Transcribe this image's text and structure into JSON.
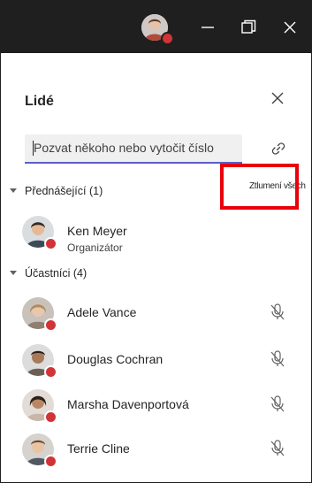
{
  "panel": {
    "title": "Lidé",
    "search_placeholder": "Pozvat někoho nebo vytočit číslo"
  },
  "presenters": {
    "header": "Přednášející (1)",
    "mute_all_label": "Ztlumení všech",
    "people": [
      {
        "name": "Ken Meyer",
        "role": "Organizátor",
        "presence": "busy"
      }
    ]
  },
  "attendees": {
    "header": "Účastníci (4)",
    "people": [
      {
        "name": "Adele Vance",
        "presence": "busy",
        "mic": "muted"
      },
      {
        "name": "Douglas Cochran",
        "presence": "busy",
        "mic": "muted"
      },
      {
        "name": "Marsha Davenportová",
        "presence": "busy",
        "mic": "muted"
      },
      {
        "name": "Terrie Cline",
        "presence": "busy",
        "mic": "muted"
      }
    ]
  },
  "colors": {
    "titlebar": "#1f1f1f",
    "presence_busy": "#d13438",
    "accent": "#5b5fc7",
    "highlight": "#e8000b"
  },
  "icons": [
    "user-avatar-icon",
    "minimize-icon",
    "restore-icon",
    "close-icon",
    "link-icon",
    "collapse-triangle-icon",
    "mic-off-icon"
  ]
}
